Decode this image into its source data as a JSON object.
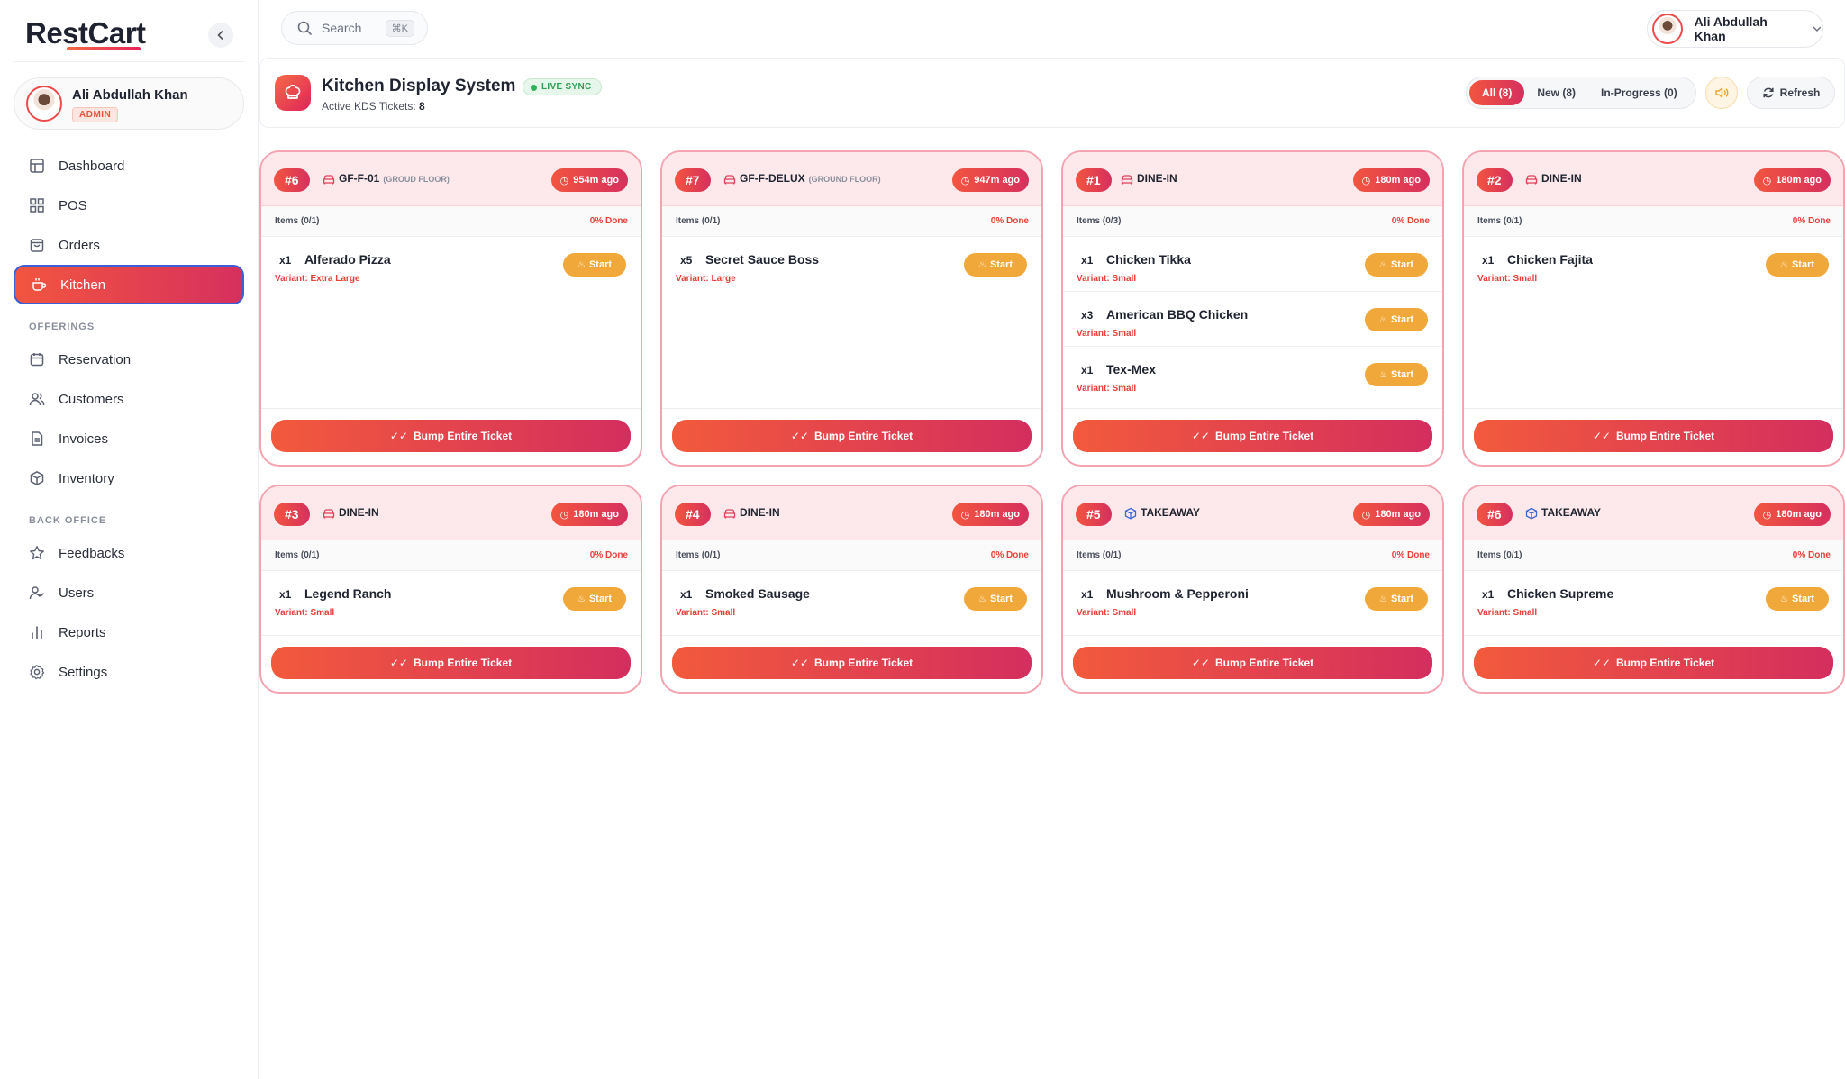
{
  "app": {
    "logo": "RestCart"
  },
  "sidebar": {
    "profile": {
      "name": "Ali Abdullah Khan",
      "role": "ADMIN"
    },
    "items": [
      {
        "label": "Dashboard",
        "icon": "layout-icon"
      },
      {
        "label": "POS",
        "icon": "grid-icon"
      },
      {
        "label": "Orders",
        "icon": "shopping-bag-icon"
      },
      {
        "label": "Kitchen",
        "icon": "coffee-icon",
        "active": true
      }
    ],
    "offerings_label": "OFFERINGS",
    "offerings": [
      {
        "label": "Reservation",
        "icon": "calendar-icon"
      },
      {
        "label": "Customers",
        "icon": "users-icon"
      },
      {
        "label": "Invoices",
        "icon": "file-text-icon"
      },
      {
        "label": "Inventory",
        "icon": "package-icon"
      }
    ],
    "backoffice_label": "BACK OFFICE",
    "backoffice": [
      {
        "label": "Feedbacks",
        "icon": "star-icon"
      },
      {
        "label": "Users",
        "icon": "user-check-icon"
      },
      {
        "label": "Reports",
        "icon": "bar-chart-icon"
      },
      {
        "label": "Settings",
        "icon": "gear-icon"
      }
    ]
  },
  "topbar": {
    "search_placeholder": "Search",
    "search_shortcut": "⌘K",
    "user_name": "Ali Abdullah Khan"
  },
  "kds": {
    "title": "Kitchen Display System",
    "live_label": "LIVE SYNC",
    "active_label": "Active KDS Tickets:",
    "active_count": "8",
    "filters": [
      "All (8)",
      "New (8)",
      "In-Progress (0)"
    ],
    "refresh_label": "Refresh"
  },
  "tickets": [
    {
      "num": "#6",
      "type": "dine",
      "table": "GF-F-01",
      "floor": "(GROUD FLOOR)",
      "time": "954m ago",
      "items_count": "Items (0/1)",
      "done": "0% Done",
      "items": [
        {
          "qty": "x1",
          "name": "Alferado Pizza",
          "variant": "Variant: Extra Large"
        }
      ]
    },
    {
      "num": "#7",
      "type": "dine",
      "table": "GF-F-DELUX",
      "floor": "(GROUND FLOOR)",
      "time": "947m ago",
      "items_count": "Items (0/1)",
      "done": "0% Done",
      "items": [
        {
          "qty": "x5",
          "name": "Secret Sauce Boss",
          "variant": "Variant: Large"
        }
      ]
    },
    {
      "num": "#1",
      "type": "dine",
      "table": "DINE-IN",
      "floor": "",
      "time": "180m ago",
      "items_count": "Items (0/3)",
      "done": "0% Done",
      "items": [
        {
          "qty": "x1",
          "name": "Chicken Tikka",
          "variant": "Variant: Small"
        },
        {
          "qty": "x3",
          "name": "American BBQ Chicken",
          "variant": "Variant: Small"
        },
        {
          "qty": "x1",
          "name": "Tex-Mex",
          "variant": "Variant: Small"
        }
      ]
    },
    {
      "num": "#2",
      "type": "dine",
      "table": "DINE-IN",
      "floor": "",
      "time": "180m ago",
      "items_count": "Items (0/1)",
      "done": "0% Done",
      "items": [
        {
          "qty": "x1",
          "name": "Chicken Fajita",
          "variant": "Variant: Small"
        }
      ]
    },
    {
      "num": "#3",
      "type": "dine",
      "table": "DINE-IN",
      "floor": "",
      "time": "180m ago",
      "items_count": "Items (0/1)",
      "done": "0% Done",
      "items": [
        {
          "qty": "x1",
          "name": "Legend Ranch",
          "variant": "Variant: Small"
        }
      ]
    },
    {
      "num": "#4",
      "type": "dine",
      "table": "DINE-IN",
      "floor": "",
      "time": "180m ago",
      "items_count": "Items (0/1)",
      "done": "0% Done",
      "items": [
        {
          "qty": "x1",
          "name": "Smoked Sausage",
          "variant": "Variant: Small"
        }
      ]
    },
    {
      "num": "#5",
      "type": "take",
      "table": "TAKEAWAY",
      "floor": "",
      "time": "180m ago",
      "items_count": "Items (0/1)",
      "done": "0% Done",
      "items": [
        {
          "qty": "x1",
          "name": "Mushroom & Pepperoni",
          "variant": "Variant: Small"
        }
      ]
    },
    {
      "num": "#6",
      "type": "take",
      "table": "TAKEAWAY",
      "floor": "",
      "time": "180m ago",
      "items_count": "Items (0/1)",
      "done": "0% Done",
      "items": [
        {
          "qty": "x1",
          "name": "Chicken Supreme",
          "variant": "Variant: Small"
        }
      ]
    }
  ],
  "labels": {
    "start": "Start",
    "bump": "Bump Entire Ticket"
  },
  "colors": {
    "accent": "#e8433f",
    "accent_end": "#d6305e",
    "start": "#f1a83a",
    "live": "#2f9e55"
  }
}
